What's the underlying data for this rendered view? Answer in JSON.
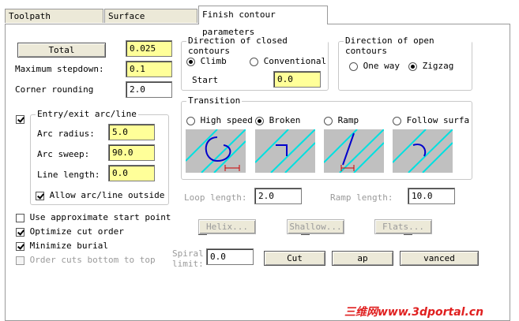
{
  "tabs": {
    "toolpath": "Toolpath parameters",
    "surface": "Surface parameters",
    "finish": "Finish contour parameters"
  },
  "params": {
    "total_tolerance_label": "Total tolerance...",
    "total_tolerance_value": "0.025",
    "max_stepdown_label": "Maximum stepdown:",
    "max_stepdown_value": "0.1",
    "corner_rounding_label": "Corner rounding",
    "corner_rounding_value": "2.0"
  },
  "closed_contours": {
    "title": "Direction of closed contours",
    "climb": "Climb",
    "conventional": "Conventional",
    "start_label": "Start",
    "start_value": "0.0",
    "selected": "climb"
  },
  "open_contours": {
    "title": "Direction of open contours",
    "one_way": "One way",
    "zigzag": "Zigzag",
    "selected": "zigzag"
  },
  "entry_exit": {
    "title": "Entry/exit arc/line",
    "arc_radius_label": "Arc radius:",
    "arc_radius_value": "5.0",
    "arc_sweep_label": "Arc sweep:",
    "arc_sweep_value": "90.0",
    "line_length_label": "Line length:",
    "line_length_value": "0.0",
    "allow_outside_label": "Allow arc/line outside bo",
    "enabled": true,
    "allow_outside": true
  },
  "transition": {
    "title": "Transition",
    "high_speed": "High speed",
    "broken": "Broken",
    "ramp": "Ramp",
    "follow_surface": "Follow surfac",
    "selected": "broken",
    "loop_length_label": "Loop length:",
    "loop_length_value": "2.0",
    "ramp_length_label": "Ramp length:",
    "ramp_length_value": "10.0"
  },
  "options": {
    "use_approx_start": "Use approximate start point",
    "optimize_cut_order": "Optimize cut order",
    "minimize_burial": "Minimize burial",
    "order_cuts_bottom": "Order cuts bottom to top",
    "use_approx_start_checked": false,
    "optimize_cut_order_checked": true,
    "minimize_burial_checked": true,
    "order_cuts_bottom_checked": false
  },
  "buttons": {
    "helix": "Helix...",
    "shallow": "Shallow...",
    "flats": "Flats...",
    "cut_depths": "Cut depths...",
    "gap_settings": "ap settings...",
    "advanced_settings": "vanced settings..."
  },
  "spiral": {
    "label_line1": "Spiral",
    "label_line2": "limit:",
    "value": "0.0"
  },
  "watermark": "三维网www.3dportal.cn",
  "colors": {
    "highlight_input": "#ffff99",
    "diagram_bg": "#c0c0c0",
    "diagram_line": "#00e0e0",
    "diagram_tool": "#0000cc",
    "diagram_dim": "#cc0000",
    "watermark": "#e02020"
  }
}
